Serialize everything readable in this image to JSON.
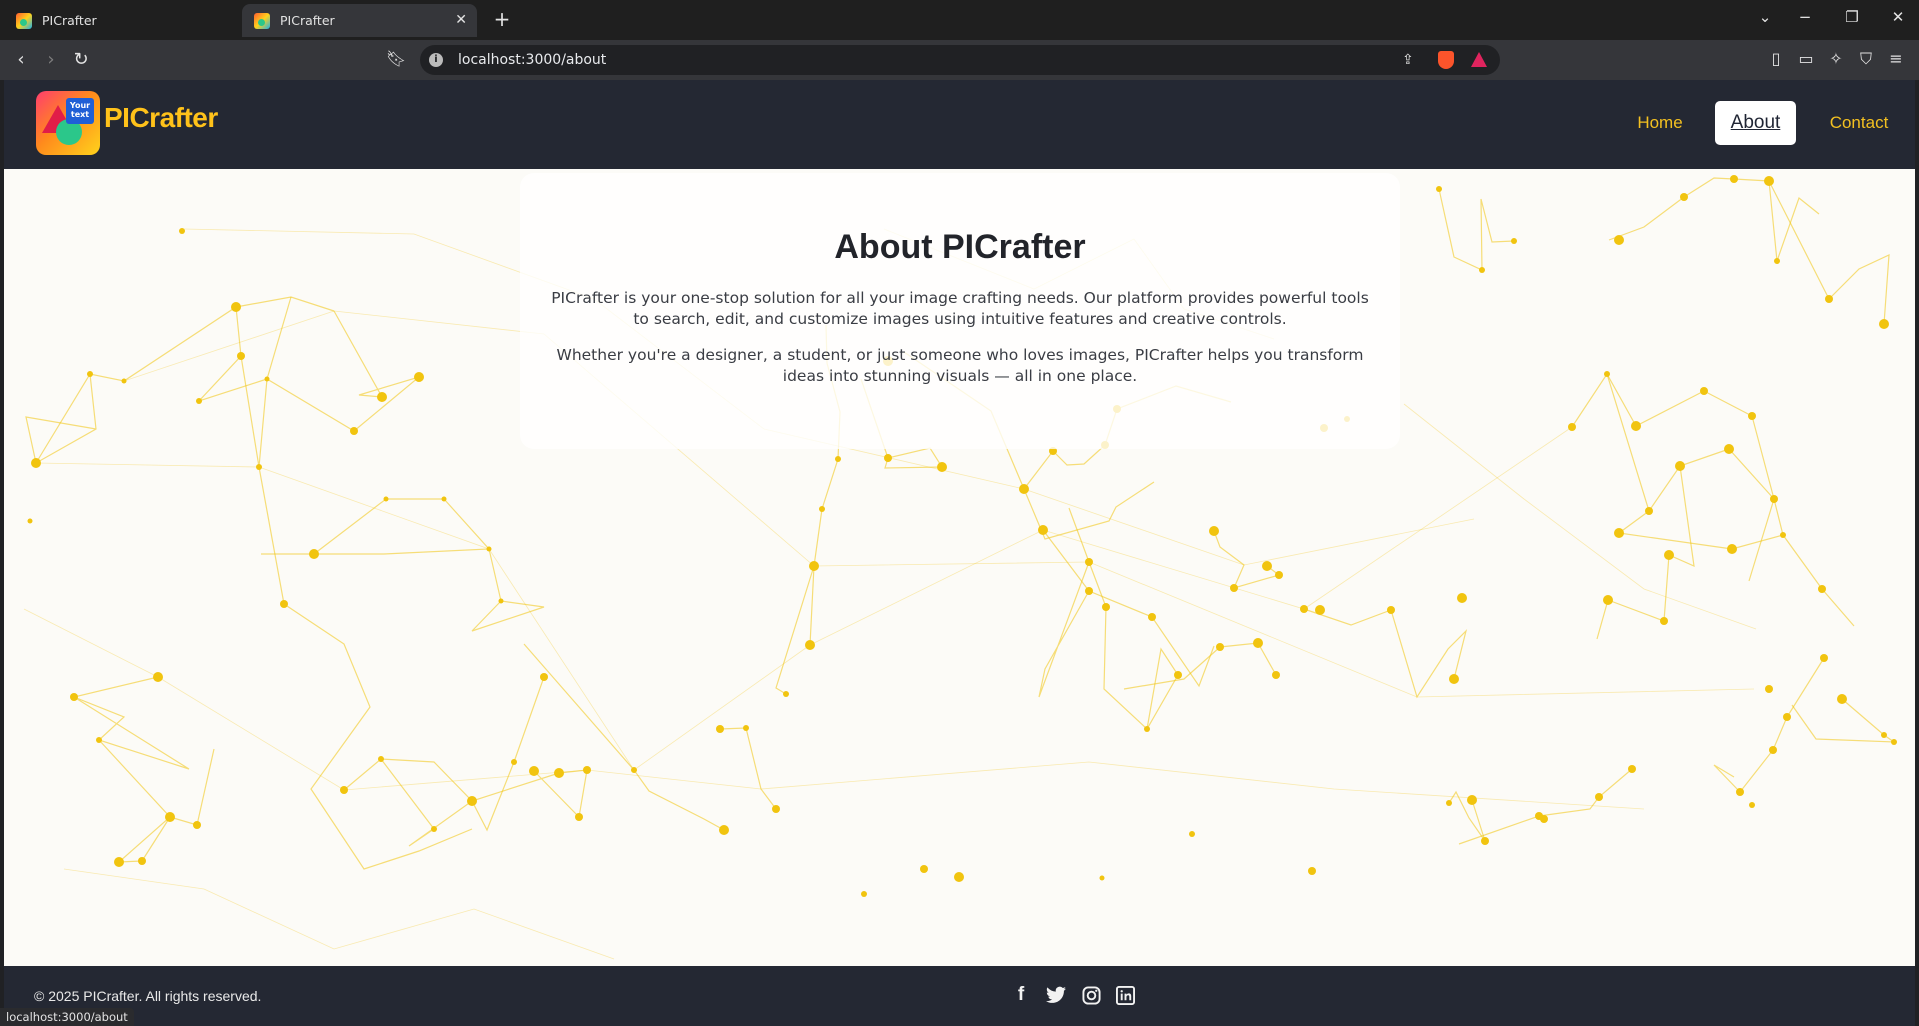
{
  "browser": {
    "tabs": [
      {
        "title": "PICrafter",
        "active": false
      },
      {
        "title": "PICrafter",
        "active": true
      }
    ],
    "url": "localhost:3000/about",
    "status_url": "localhost:3000/about"
  },
  "site": {
    "brand": "PICrafter",
    "logo_text": "Your text",
    "nav": [
      {
        "label": "Home",
        "active": false
      },
      {
        "label": "About",
        "active": true
      },
      {
        "label": "Contact",
        "active": false
      }
    ],
    "accent_color": "#f5c518",
    "header_color": "#242833"
  },
  "about": {
    "title": "About PICrafter",
    "paragraph1": "PICrafter is your one-stop solution for all your image crafting needs. Our platform provides powerful tools to search, edit, and customize images using intuitive features and creative controls.",
    "paragraph2": "Whether you're a designer, a student, or just someone who loves images, PICrafter helps you transform ideas into stunning visuals — all in one place."
  },
  "footer": {
    "copyright": "© 2025 PICrafter. All rights reserved.",
    "social": [
      "facebook-icon",
      "twitter-icon",
      "instagram-icon",
      "linkedin-icon"
    ]
  }
}
